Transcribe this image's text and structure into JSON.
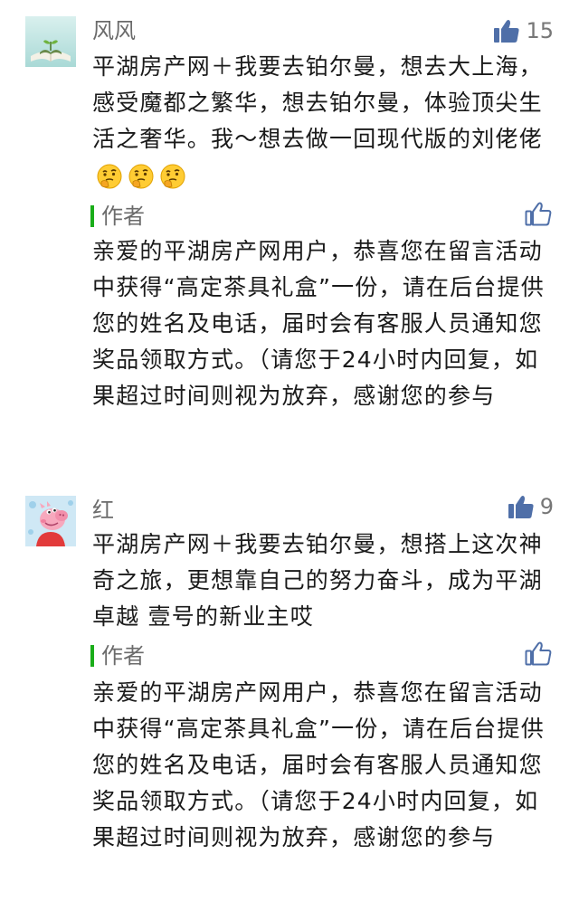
{
  "comments": [
    {
      "nickname": "风风",
      "likes": "15",
      "text": "平湖房产网＋我要去铂尔曼，想去大上海，感受魔都之繁华，想去铂尔曼，体验顶尖生活之奢华。我～想去做一回现代版的刘佬佬",
      "emoji": "thinking-face-icon",
      "reply": {
        "author": "作者",
        "text": "亲爱的平湖房产网用户，恭喜您在留言活动中获得“高定茶具礼盒”一份，请在后台提供您的姓名及电话，届时会有客服人员通知您奖品领取方式。（请您于24小时内回复，如果超过时间则视为放弃，感谢您的参与"
      }
    },
    {
      "nickname": "红",
      "likes": "9",
      "text": "平湖房产网＋我要去铂尔曼，想搭上这次神奇之旅，更想靠自己的努力奋斗，成为平湖卓越 壹号的新业主哎",
      "reply": {
        "author": "作者",
        "text": "亲爱的平湖房产网用户，恭喜您在留言活动中获得“高定茶具礼盒”一份，请在后台提供您的姓名及电话，届时会有客服人员通知您奖品领取方式。（请您于24小时内回复，如果超过时间则视为放弃，感谢您的参与"
      }
    }
  ],
  "colors": {
    "accent_bar": "#1aad19",
    "like_filled": "#4f6fa8",
    "meta_text": "#6b6b6b"
  }
}
